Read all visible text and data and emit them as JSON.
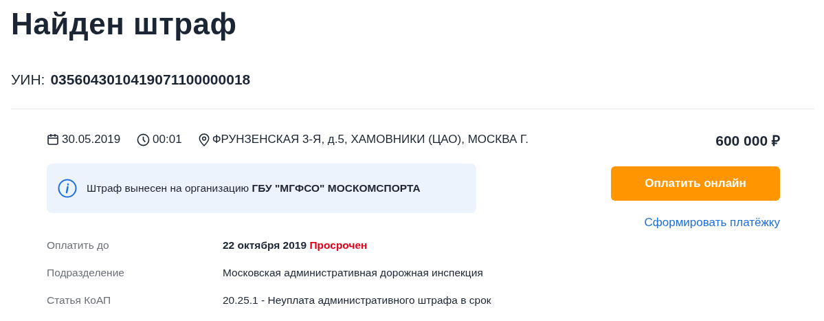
{
  "title": "Найден штраф",
  "uin": {
    "label": "УИН:",
    "value": "0356043010419071100000018"
  },
  "meta": {
    "date": "30.05.2019",
    "time": "00:01",
    "address": "ФРУНЗЕНСКАЯ 3-Я, д.5, ХАМОВНИКИ (ЦАО), МОСКВА Г."
  },
  "notice": "Штраф вынесен на организацию **ГБУ \"МГФСО\" МОСКОМСПОРТА**",
  "amount": "600 000 ₽",
  "pay_button": "Оплатить онлайн",
  "payment_link": "Сформировать платёжку",
  "details": [
    {
      "label": "Оплатить до",
      "value": "22 октября 2019",
      "bold": true,
      "status": "Просрочен"
    },
    {
      "label": "Подразделение",
      "value": "Московская административная дорожная инспекция",
      "bold": false
    },
    {
      "label": "Статья КоАП",
      "value": "20.25.1 - Неуплата административного штрафа в срок",
      "bold": false
    }
  ]
}
